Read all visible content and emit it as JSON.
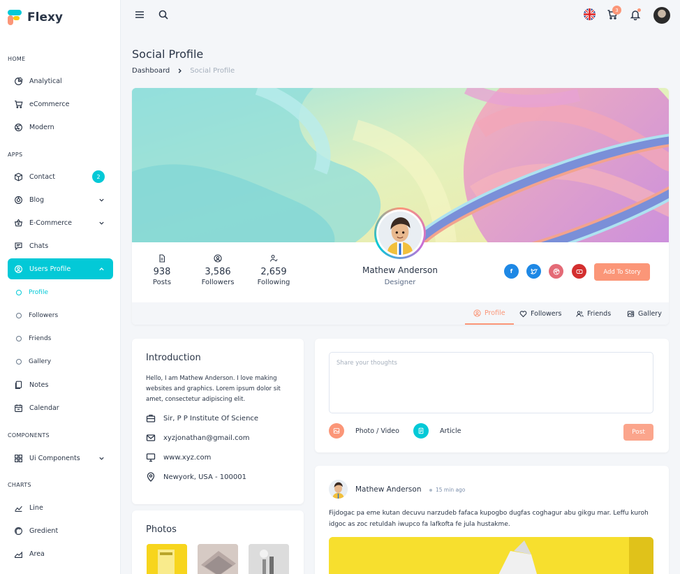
{
  "app": {
    "name": "Flexy"
  },
  "sidebar": {
    "captions": {
      "home": "HOME",
      "apps": "APPS",
      "components": "COMPONENTS",
      "charts": "CHARTS"
    },
    "home_items": [
      {
        "label": "Analytical",
        "icon": "chart-pie-icon"
      },
      {
        "label": "eCommerce",
        "icon": "cart-icon"
      },
      {
        "label": "Modern",
        "icon": "aperture-icon"
      }
    ],
    "apps_items": [
      {
        "label": "Contact",
        "icon": "box-icon",
        "badge": "2"
      },
      {
        "label": "Blog",
        "icon": "chart-donut-icon"
      },
      {
        "label": "E-Commerce",
        "icon": "basket-icon"
      },
      {
        "label": "Chats",
        "icon": "message-icon"
      },
      {
        "label": "Users Profile",
        "icon": "user-circle-icon"
      }
    ],
    "profile_sub": [
      "Profile",
      "Followers",
      "Friends",
      "Gallery"
    ],
    "apps_more": [
      {
        "label": "Notes",
        "icon": "notes-icon"
      },
      {
        "label": "Calendar",
        "icon": "calendar-icon"
      }
    ],
    "components_items": [
      {
        "label": "Ui Components",
        "icon": "layout-grid-icon"
      }
    ],
    "charts_items": [
      {
        "label": "Line",
        "icon": "line-chart-icon"
      },
      {
        "label": "Gredient",
        "icon": "gradient-icon"
      },
      {
        "label": "Area",
        "icon": "area-chart-icon"
      }
    ],
    "active_color": "#03c9d7"
  },
  "topbar": {
    "cart_count": "3"
  },
  "page": {
    "title": "Social Profile",
    "breadcrumb": [
      "Dashboard",
      "Social Profile"
    ]
  },
  "profile": {
    "stats": [
      {
        "value": "938",
        "label": "Posts"
      },
      {
        "value": "3,586",
        "label": "Followers"
      },
      {
        "value": "2,659",
        "label": "Following"
      }
    ],
    "name": "Mathew Anderson",
    "role": "Designer",
    "social": [
      {
        "name": "facebook-icon",
        "color": "#1e88e5"
      },
      {
        "name": "twitter-icon",
        "color": "#1e88e5"
      },
      {
        "name": "dribbble-icon",
        "color": "#e46a76"
      },
      {
        "name": "youtube-icon",
        "color": "#d32f2f"
      }
    ],
    "story_button": "Add To Story",
    "tabs": [
      "Profile",
      "Followers",
      "Friends",
      "Gallery"
    ],
    "accent": "#fb9678"
  },
  "intro": {
    "title": "Introduction",
    "text": "Hello, I am Mathew Anderson. I love making websites and graphics. Lorem ipsum dolor sit amet, consectetur adipiscing elit.",
    "rows": [
      {
        "icon": "briefcase-icon",
        "text": "Sir, P P Institute Of Science"
      },
      {
        "icon": "mail-icon",
        "text": "xyzjonathan@gmail.com"
      },
      {
        "icon": "desktop-icon",
        "text": "www.xyz.com"
      },
      {
        "icon": "location-icon",
        "text": "Newyork, USA - 100001"
      }
    ]
  },
  "photos": {
    "title": "Photos"
  },
  "composer": {
    "placeholder": "Share your thoughts",
    "photo_label": "Photo / Video",
    "article_label": "Article",
    "post_label": "Post"
  },
  "feed": {
    "author": "Mathew Anderson",
    "time": "15 min ago",
    "text": "Fijdogac pa eme kutan decuvu narzudeb fafaca kupogbo dugfas coghagur abu gikgu mar. Leffu kuroh idgoc as zoc retuldah iwupco fa lafkofta fe jula hustakme."
  }
}
